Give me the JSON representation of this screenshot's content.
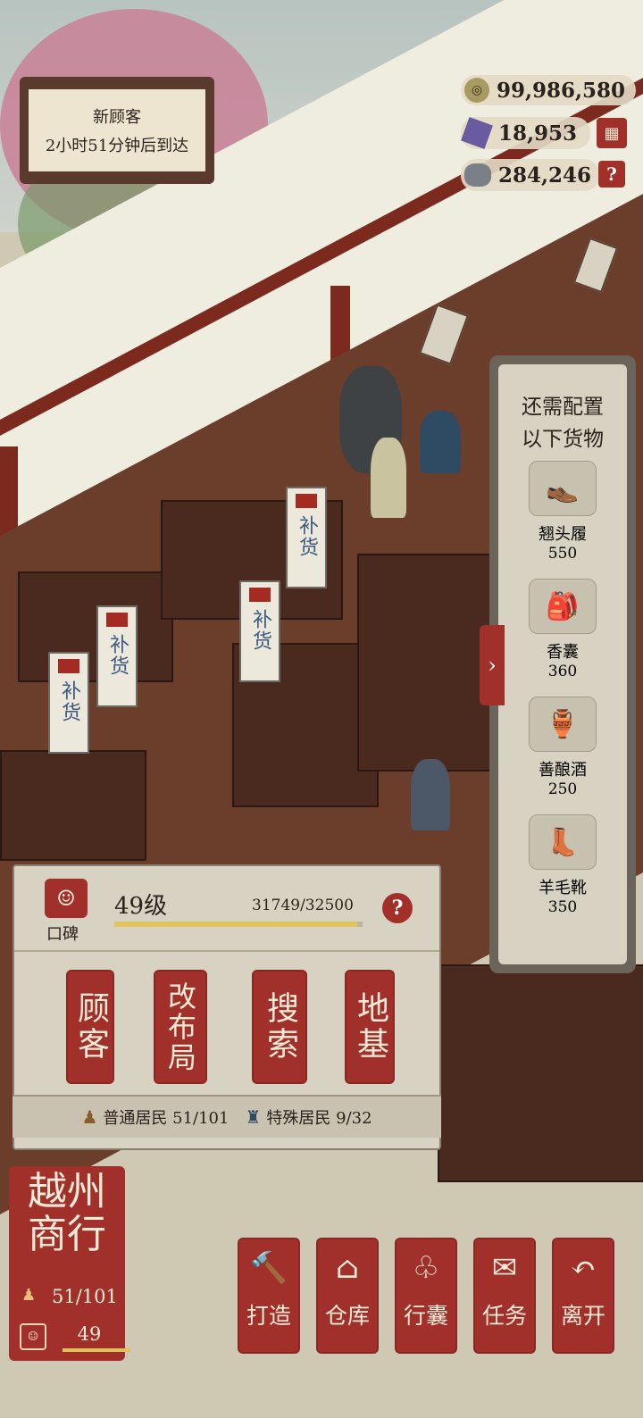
{
  "notice": {
    "title": "新顾客",
    "subtitle": "2小时51分钟后到达"
  },
  "currency": [
    {
      "name": "coin",
      "icon": "coin-icon",
      "value": "99,986,580"
    },
    {
      "name": "jade",
      "icon": "gem-icon",
      "value": "18,953"
    },
    {
      "name": "ore",
      "icon": "ore-icon",
      "value": "284,246"
    }
  ],
  "goods_panel": {
    "title_line1": "还需配置",
    "title_line2": "以下货物",
    "items": [
      {
        "name": "翘头履",
        "count": "550",
        "icon": "shoe-icon"
      },
      {
        "name": "香囊",
        "count": "360",
        "icon": "sachet-icon"
      },
      {
        "name": "善酿酒",
        "count": "250",
        "icon": "wine-jar-icon"
      },
      {
        "name": "羊毛靴",
        "count": "350",
        "icon": "boot-icon"
      }
    ]
  },
  "banners": [
    "补货",
    "补货",
    "补货",
    "补货"
  ],
  "reputation": {
    "label": "口碑",
    "level": "49级",
    "progress_text": "31749/32500",
    "progress": 0.977
  },
  "actions": [
    "顾客",
    "改布局",
    "搜索",
    "地基"
  ],
  "residents": {
    "normal": "普通居民 51/101",
    "special": "特殊居民 9/32"
  },
  "shop": {
    "name_line1": "越州",
    "name_line2": "商行",
    "residents": "51/101",
    "level": "49"
  },
  "bottom_menu": [
    {
      "label": "打造",
      "icon": "hammer-icon"
    },
    {
      "label": "仓库",
      "icon": "warehouse-icon"
    },
    {
      "label": "行囊",
      "icon": "bundle-icon"
    },
    {
      "label": "任务",
      "icon": "scroll-icon"
    },
    {
      "label": "离开",
      "icon": "return-icon"
    }
  ],
  "colors": {
    "accent_red": "#a1302a",
    "panel": "#d8d2c2",
    "progress": "#e2c25a"
  }
}
